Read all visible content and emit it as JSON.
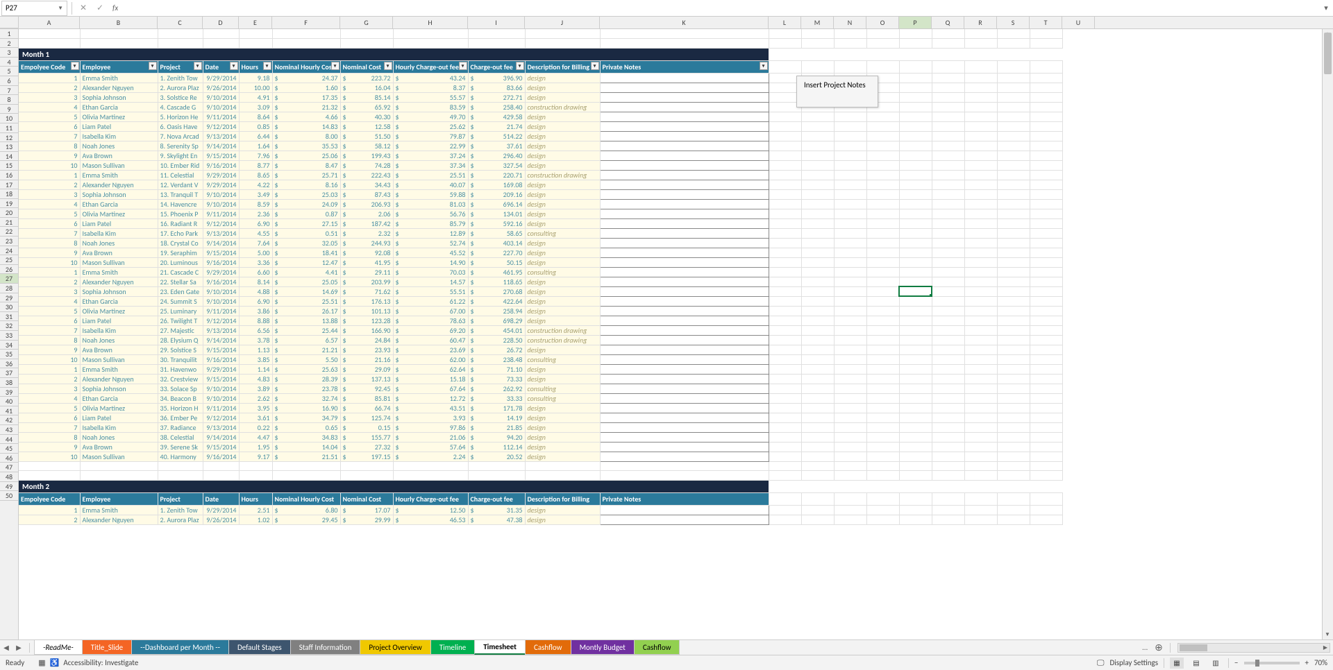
{
  "nameBox": "P27",
  "formulaValue": "",
  "tooltip": "Insert Project Notes",
  "colHeaders": [
    "A",
    "B",
    "C",
    "D",
    "E",
    "F",
    "G",
    "H",
    "I",
    "J",
    "K",
    "L",
    "M",
    "N",
    "O",
    "P",
    "Q",
    "R",
    "S",
    "T",
    "U"
  ],
  "selectedCol": "P",
  "selectedRow": 27,
  "month1": {
    "title": "Month 1",
    "headers": [
      "Empolyee Code",
      "Employee",
      "Project",
      "Date",
      "Hours",
      "Nominal Hourly Cost",
      "Nominal Cost",
      "Hourly Charge-out fee",
      "Charge-out fee",
      "Description for Billing",
      "Private Notes"
    ],
    "rows": [
      {
        "code": "1",
        "emp": "Emma Smith",
        "proj": "1. Zenith Tow",
        "date": "9/29/2014",
        "hours": "9.18",
        "nhc": "24.37",
        "nc": "223.72",
        "hcf": "43.24",
        "cof": "396.90",
        "desc": "design"
      },
      {
        "code": "2",
        "emp": "Alexander Nguyen",
        "proj": "2. Aurora Plaz",
        "date": "9/26/2014",
        "hours": "10.00",
        "nhc": "1.60",
        "nc": "16.04",
        "hcf": "8.37",
        "cof": "83.66",
        "desc": "design"
      },
      {
        "code": "3",
        "emp": "Sophia Johnson",
        "proj": "3. Solstice Re",
        "date": "9/10/2014",
        "hours": "4.91",
        "nhc": "17.35",
        "nc": "85.14",
        "hcf": "55.57",
        "cof": "272.71",
        "desc": "design"
      },
      {
        "code": "4",
        "emp": "Ethan Garcia",
        "proj": "4. Cascade G",
        "date": "9/10/2014",
        "hours": "3.09",
        "nhc": "21.32",
        "nc": "65.92",
        "hcf": "83.59",
        "cof": "258.40",
        "desc": "construction drawing"
      },
      {
        "code": "5",
        "emp": "Olivia Martinez",
        "proj": "5. Horizon He",
        "date": "9/11/2014",
        "hours": "8.64",
        "nhc": "4.66",
        "nc": "40.30",
        "hcf": "49.70",
        "cof": "429.58",
        "desc": "design"
      },
      {
        "code": "6",
        "emp": "Liam Patel",
        "proj": "6. Oasis Have",
        "date": "9/12/2014",
        "hours": "0.85",
        "nhc": "14.83",
        "nc": "12.58",
        "hcf": "25.62",
        "cof": "21.74",
        "desc": "design"
      },
      {
        "code": "7",
        "emp": "Isabella Kim",
        "proj": "7. Nova Arcad",
        "date": "9/13/2014",
        "hours": "6.44",
        "nhc": "8.00",
        "nc": "51.50",
        "hcf": "79.87",
        "cof": "514.22",
        "desc": "design"
      },
      {
        "code": "8",
        "emp": "Noah Jones",
        "proj": "8. Serenity Sp",
        "date": "9/14/2014",
        "hours": "1.64",
        "nhc": "35.53",
        "nc": "58.12",
        "hcf": "22.99",
        "cof": "37.61",
        "desc": "design"
      },
      {
        "code": "9",
        "emp": "Ava Brown",
        "proj": "9. Skylight En",
        "date": "9/15/2014",
        "hours": "7.96",
        "nhc": "25.06",
        "nc": "199.43",
        "hcf": "37.24",
        "cof": "296.40",
        "desc": "design"
      },
      {
        "code": "10",
        "emp": "Mason Sullivan",
        "proj": "10. Ember Rid",
        "date": "9/16/2014",
        "hours": "8.77",
        "nhc": "8.47",
        "nc": "74.28",
        "hcf": "37.34",
        "cof": "327.54",
        "desc": "design"
      },
      {
        "code": "1",
        "emp": "Emma Smith",
        "proj": "11. Celestial",
        "date": "9/29/2014",
        "hours": "8.65",
        "nhc": "25.71",
        "nc": "222.43",
        "hcf": "25.51",
        "cof": "220.71",
        "desc": "construction drawing"
      },
      {
        "code": "2",
        "emp": "Alexander Nguyen",
        "proj": "12. Verdant V",
        "date": "9/29/2014",
        "hours": "4.22",
        "nhc": "8.16",
        "nc": "34.43",
        "hcf": "40.07",
        "cof": "169.08",
        "desc": "design"
      },
      {
        "code": "3",
        "emp": "Sophia Johnson",
        "proj": "13. Tranquil T",
        "date": "9/10/2014",
        "hours": "3.49",
        "nhc": "25.03",
        "nc": "87.43",
        "hcf": "59.88",
        "cof": "209.16",
        "desc": "design"
      },
      {
        "code": "4",
        "emp": "Ethan Garcia",
        "proj": "14. Havencre",
        "date": "9/10/2014",
        "hours": "8.59",
        "nhc": "24.09",
        "nc": "206.93",
        "hcf": "81.03",
        "cof": "696.14",
        "desc": "design"
      },
      {
        "code": "5",
        "emp": "Olivia Martinez",
        "proj": "15. Phoenix P",
        "date": "9/11/2014",
        "hours": "2.36",
        "nhc": "0.87",
        "nc": "2.06",
        "hcf": "56.76",
        "cof": "134.01",
        "desc": "design"
      },
      {
        "code": "6",
        "emp": "Liam Patel",
        "proj": "16. Radiant R",
        "date": "9/12/2014",
        "hours": "6.90",
        "nhc": "27.15",
        "nc": "187.42",
        "hcf": "85.79",
        "cof": "592.16",
        "desc": "design"
      },
      {
        "code": "7",
        "emp": "Isabella Kim",
        "proj": "17. Echo Park",
        "date": "9/13/2014",
        "hours": "4.55",
        "nhc": "0.51",
        "nc": "2.32",
        "hcf": "12.89",
        "cof": "58.65",
        "desc": "consulting"
      },
      {
        "code": "8",
        "emp": "Noah Jones",
        "proj": "18. Crystal Co",
        "date": "9/14/2014",
        "hours": "7.64",
        "nhc": "32.05",
        "nc": "244.93",
        "hcf": "52.74",
        "cof": "403.14",
        "desc": "design"
      },
      {
        "code": "9",
        "emp": "Ava Brown",
        "proj": "19. Seraphim",
        "date": "9/15/2014",
        "hours": "5.00",
        "nhc": "18.41",
        "nc": "92.08",
        "hcf": "45.52",
        "cof": "227.70",
        "desc": "design"
      },
      {
        "code": "10",
        "emp": "Mason Sullivan",
        "proj": "20. Luminous",
        "date": "9/16/2014",
        "hours": "3.36",
        "nhc": "12.47",
        "nc": "41.95",
        "hcf": "14.90",
        "cof": "50.15",
        "desc": "design"
      },
      {
        "code": "1",
        "emp": "Emma Smith",
        "proj": "21. Cascade C",
        "date": "9/29/2014",
        "hours": "6.60",
        "nhc": "4.41",
        "nc": "29.11",
        "hcf": "70.03",
        "cof": "461.95",
        "desc": "consulting"
      },
      {
        "code": "2",
        "emp": "Alexander Nguyen",
        "proj": "22. Stellar Sa",
        "date": "9/16/2014",
        "hours": "8.14",
        "nhc": "25.05",
        "nc": "203.99",
        "hcf": "14.57",
        "cof": "118.65",
        "desc": "design"
      },
      {
        "code": "3",
        "emp": "Sophia Johnson",
        "proj": "23. Eden Gate",
        "date": "9/10/2014",
        "hours": "4.88",
        "nhc": "14.69",
        "nc": "71.62",
        "hcf": "55.51",
        "cof": "270.68",
        "desc": "design"
      },
      {
        "code": "4",
        "emp": "Ethan Garcia",
        "proj": "24. Summit S",
        "date": "9/10/2014",
        "hours": "6.90",
        "nhc": "25.51",
        "nc": "176.13",
        "hcf": "61.22",
        "cof": "422.64",
        "desc": "design"
      },
      {
        "code": "5",
        "emp": "Olivia Martinez",
        "proj": "25. Luminary",
        "date": "9/11/2014",
        "hours": "3.86",
        "nhc": "26.17",
        "nc": "101.13",
        "hcf": "67.00",
        "cof": "258.94",
        "desc": "design"
      },
      {
        "code": "6",
        "emp": "Liam Patel",
        "proj": "26. Twilight T",
        "date": "9/12/2014",
        "hours": "8.88",
        "nhc": "13.88",
        "nc": "123.28",
        "hcf": "78.63",
        "cof": "698.29",
        "desc": "design"
      },
      {
        "code": "7",
        "emp": "Isabella Kim",
        "proj": "27. Majestic",
        "date": "9/13/2014",
        "hours": "6.56",
        "nhc": "25.44",
        "nc": "166.90",
        "hcf": "69.20",
        "cof": "454.01",
        "desc": "construction drawing"
      },
      {
        "code": "8",
        "emp": "Noah Jones",
        "proj": "28. Elysium Q",
        "date": "9/14/2014",
        "hours": "3.78",
        "nhc": "6.57",
        "nc": "24.84",
        "hcf": "60.47",
        "cof": "228.50",
        "desc": "construction drawing"
      },
      {
        "code": "9",
        "emp": "Ava Brown",
        "proj": "29. Solstice S",
        "date": "9/15/2014",
        "hours": "1.13",
        "nhc": "21.21",
        "nc": "23.93",
        "hcf": "23.69",
        "cof": "26.72",
        "desc": "design"
      },
      {
        "code": "10",
        "emp": "Mason Sullivan",
        "proj": "30. Tranquilit",
        "date": "9/16/2014",
        "hours": "3.85",
        "nhc": "5.50",
        "nc": "21.16",
        "hcf": "62.00",
        "cof": "238.48",
        "desc": "consulting"
      },
      {
        "code": "1",
        "emp": "Emma Smith",
        "proj": "31. Havenwo",
        "date": "9/29/2014",
        "hours": "1.14",
        "nhc": "25.63",
        "nc": "29.09",
        "hcf": "62.64",
        "cof": "71.10",
        "desc": "design"
      },
      {
        "code": "2",
        "emp": "Alexander Nguyen",
        "proj": "32. Crestview",
        "date": "9/15/2014",
        "hours": "4.83",
        "nhc": "28.39",
        "nc": "137.13",
        "hcf": "15.18",
        "cof": "73.33",
        "desc": "design"
      },
      {
        "code": "3",
        "emp": "Sophia Johnson",
        "proj": "33. Solace Sp",
        "date": "9/10/2014",
        "hours": "3.89",
        "nhc": "23.78",
        "nc": "92.45",
        "hcf": "67.64",
        "cof": "262.92",
        "desc": "consulting"
      },
      {
        "code": "4",
        "emp": "Ethan Garcia",
        "proj": "34. Beacon B",
        "date": "9/10/2014",
        "hours": "2.62",
        "nhc": "32.74",
        "nc": "85.81",
        "hcf": "12.72",
        "cof": "33.33",
        "desc": "consulting"
      },
      {
        "code": "5",
        "emp": "Olivia Martinez",
        "proj": "35. Horizon H",
        "date": "9/11/2014",
        "hours": "3.95",
        "nhc": "16.90",
        "nc": "66.74",
        "hcf": "43.51",
        "cof": "171.78",
        "desc": "design"
      },
      {
        "code": "6",
        "emp": "Liam Patel",
        "proj": "36. Ember Pe",
        "date": "9/12/2014",
        "hours": "3.61",
        "nhc": "34.79",
        "nc": "125.74",
        "hcf": "3.93",
        "cof": "14.19",
        "desc": "design"
      },
      {
        "code": "7",
        "emp": "Isabella Kim",
        "proj": "37. Radiance",
        "date": "9/13/2014",
        "hours": "0.22",
        "nhc": "0.65",
        "nc": "0.15",
        "hcf": "97.86",
        "cof": "21.85",
        "desc": "design"
      },
      {
        "code": "8",
        "emp": "Noah Jones",
        "proj": "38. Celestial",
        "date": "9/14/2014",
        "hours": "4.47",
        "nhc": "34.83",
        "nc": "155.77",
        "hcf": "21.06",
        "cof": "94.20",
        "desc": "design"
      },
      {
        "code": "9",
        "emp": "Ava Brown",
        "proj": "39. Serene Sk",
        "date": "9/15/2014",
        "hours": "1.95",
        "nhc": "14.04",
        "nc": "27.32",
        "hcf": "57.64",
        "cof": "112.14",
        "desc": "design"
      },
      {
        "code": "10",
        "emp": "Mason Sullivan",
        "proj": "40. Harmony",
        "date": "9/16/2014",
        "hours": "9.17",
        "nhc": "21.51",
        "nc": "197.15",
        "hcf": "2.24",
        "cof": "20.52",
        "desc": "design"
      }
    ]
  },
  "month2": {
    "title": "Month 2",
    "headers": [
      "Empolyee Code",
      "Employee",
      "Project",
      "Date",
      "Hours",
      "Nominal Hourly Cost",
      "Nominal Cost",
      "Hourly Charge-out fee",
      "Charge-out fee",
      "Description for Billing",
      "Private Notes"
    ],
    "rows": [
      {
        "code": "1",
        "emp": "Emma Smith",
        "proj": "1. Zenith Tow",
        "date": "9/29/2014",
        "hours": "2.51",
        "nhc": "6.80",
        "nc": "17.07",
        "hcf": "12.50",
        "cof": "31.35",
        "desc": "design"
      },
      {
        "code": "2",
        "emp": "Alexander Nguyen",
        "proj": "2. Aurora Plaz",
        "date": "9/26/2014",
        "hours": "1.02",
        "nhc": "29.45",
        "nc": "29.99",
        "hcf": "46.53",
        "cof": "47.38",
        "desc": "design"
      }
    ]
  },
  "sheetTabs": [
    {
      "name": "-ReadMe-",
      "cls": "tab-readme"
    },
    {
      "name": "Title_Slide",
      "cls": "tab-title"
    },
    {
      "name": "--Dashboard per Month --",
      "cls": "tab-dashboard"
    },
    {
      "name": "Default Stages",
      "cls": "tab-default"
    },
    {
      "name": "Staff Information",
      "cls": "tab-staff"
    },
    {
      "name": "Project Overview",
      "cls": "tab-project"
    },
    {
      "name": "Timeline",
      "cls": "tab-timeline"
    },
    {
      "name": "Timesheet",
      "cls": "tab-timesheet",
      "active": true
    },
    {
      "name": "Cashflow",
      "cls": "tab-cashflow1"
    },
    {
      "name": "Montly Budget",
      "cls": "tab-monthly"
    },
    {
      "name": "Cashflow",
      "cls": "tab-cashflow2"
    }
  ],
  "status": {
    "ready": "Ready",
    "accessibility": "Accessibility: Investigate",
    "displaySettings": "Display Settings",
    "zoom": "70%"
  }
}
